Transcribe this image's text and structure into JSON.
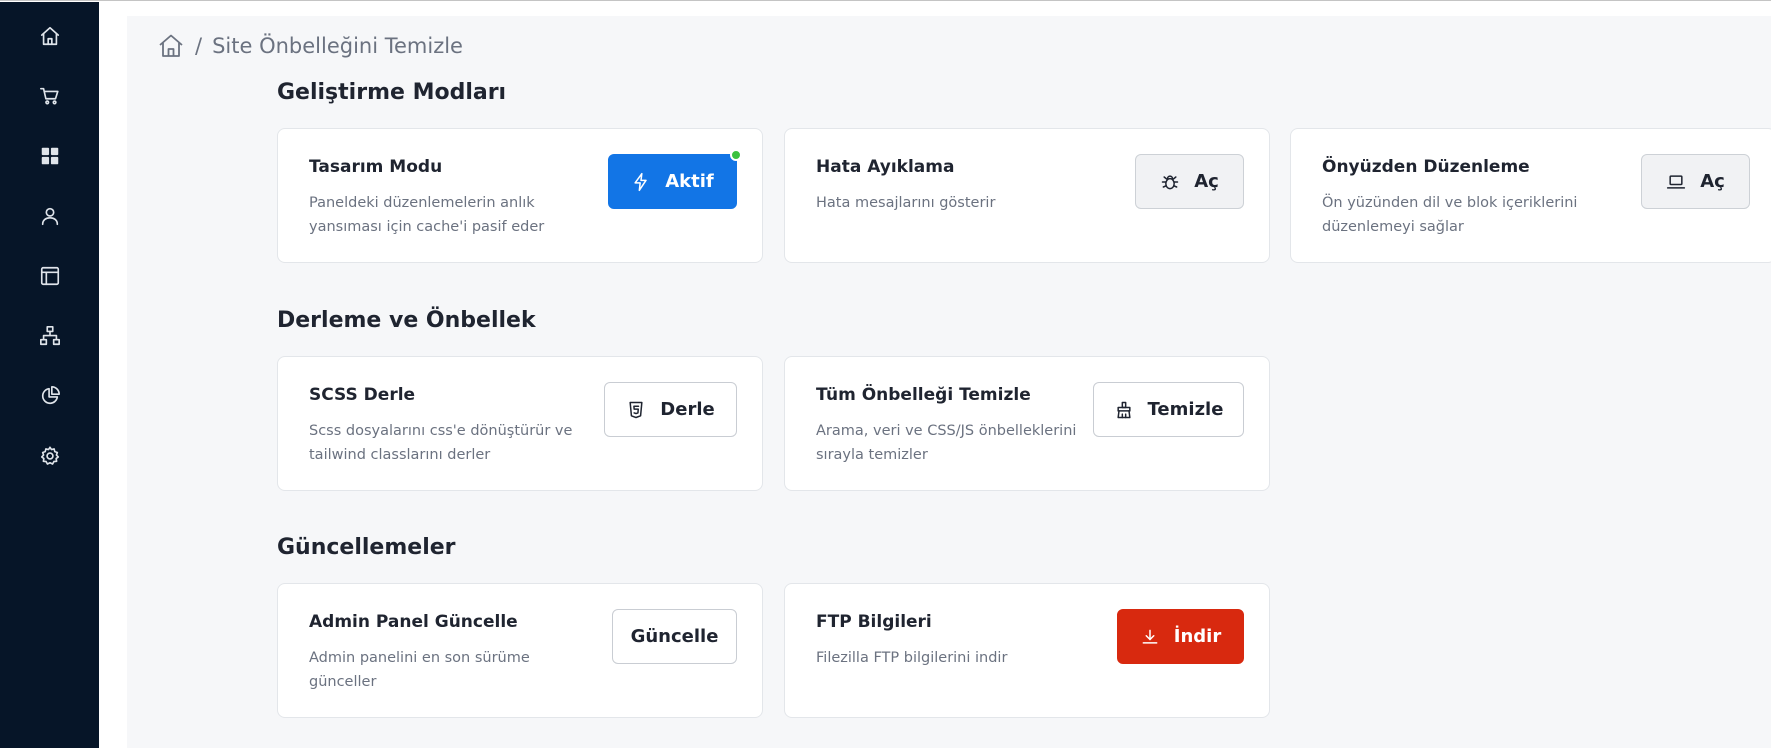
{
  "sidebar": {
    "items": [
      {
        "icon": "home-icon"
      },
      {
        "icon": "cart-icon"
      },
      {
        "icon": "dashboard-icon"
      },
      {
        "icon": "user-icon"
      },
      {
        "icon": "layout-icon"
      },
      {
        "icon": "sitemap-icon"
      },
      {
        "icon": "pie-chart-icon"
      },
      {
        "icon": "gear-icon"
      }
    ]
  },
  "breadcrumb": {
    "separator": "/",
    "current": "Site Önbelleğini Temizle"
  },
  "sections": {
    "dev": {
      "title": "Geliştirme Modları",
      "cards": [
        {
          "title": "Tasarım Modu",
          "desc": "Paneldeki düzenlemelerin anlık yansıması için cache'i pasif eder",
          "button": "Aktif",
          "status": "active"
        },
        {
          "title": "Hata Ayıklama",
          "desc": "Hata mesajlarını gösterir",
          "button": "Aç"
        },
        {
          "title": "Önyüzden Düzenleme",
          "desc": "Ön yüzünden dil ve blok içeriklerini düzenlemeyi sağlar",
          "button": "Aç"
        }
      ]
    },
    "build": {
      "title": "Derleme ve Önbellek",
      "cards": [
        {
          "title": "SCSS Derle",
          "desc": "Scss dosyalarını css'e dönüştürür ve tailwind classlarını derler",
          "button": "Derle"
        },
        {
          "title": "Tüm Önbelleği Temizle",
          "desc": "Arama, veri ve CSS/JS önbelleklerini sırayla temizler",
          "button": "Temizle"
        }
      ]
    },
    "updates": {
      "title": "Güncellemeler",
      "cards": [
        {
          "title": "Admin Panel Güncelle",
          "desc": "Admin panelini en son sürüme günceller",
          "button": "Güncelle"
        },
        {
          "title": "FTP Bilgileri",
          "desc": "Filezilla FTP bilgilerini indir",
          "button": "İndir"
        }
      ]
    }
  },
  "colors": {
    "sidebar": "#061528",
    "primary": "#1275e6",
    "danger": "#d8290f",
    "status_active": "#3cc23f"
  }
}
